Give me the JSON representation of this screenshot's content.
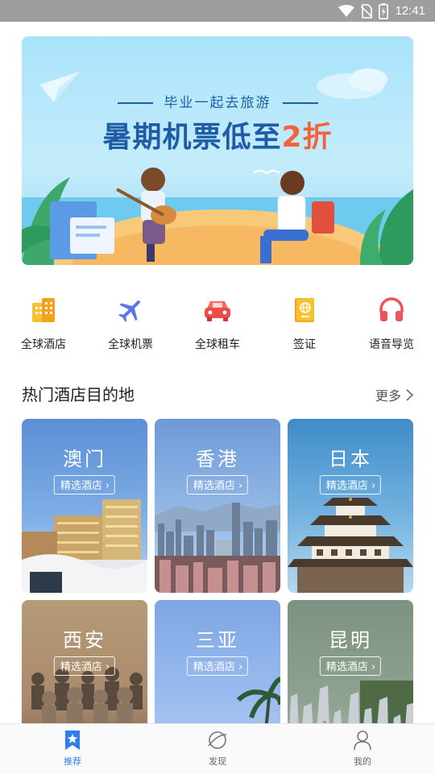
{
  "status_bar": {
    "time": "12:41",
    "icons": [
      "wifi-icon",
      "no-sim-icon",
      "battery-charging-icon"
    ]
  },
  "banner": {
    "subtitle": "毕业一起去旅游",
    "title_main": "暑期机票低至",
    "title_highlight": "2折",
    "colors": {
      "title": "#1f5ca8",
      "highlight": "#f4613b",
      "background": "#b8e8fb"
    }
  },
  "quick_menu": [
    {
      "label": "全球酒店",
      "icon": "hotel-building-icon"
    },
    {
      "label": "全球机票",
      "icon": "airplane-icon"
    },
    {
      "label": "全球租车",
      "icon": "car-icon"
    },
    {
      "label": "签证",
      "icon": "passport-icon"
    },
    {
      "label": "语音导览",
      "icon": "headphones-icon"
    }
  ],
  "section": {
    "title": "热门酒店目的地",
    "more": "更多"
  },
  "destinations": [
    {
      "name": "澳门",
      "tag": "精选酒店"
    },
    {
      "name": "香港",
      "tag": "精选酒店"
    },
    {
      "name": "日本",
      "tag": "精选酒店"
    },
    {
      "name": "西安",
      "tag": "精选酒店"
    },
    {
      "name": "三亚",
      "tag": "精选酒店"
    },
    {
      "name": "昆明",
      "tag": "精选酒店"
    }
  ],
  "tab_bar": {
    "active": "推荐",
    "tabs": [
      {
        "label": "推荐",
        "icon": "star-bookmark-icon"
      },
      {
        "label": "发现",
        "icon": "planet-icon"
      },
      {
        "label": "我的",
        "icon": "user-icon"
      }
    ],
    "accent": "#2d7cf0"
  }
}
